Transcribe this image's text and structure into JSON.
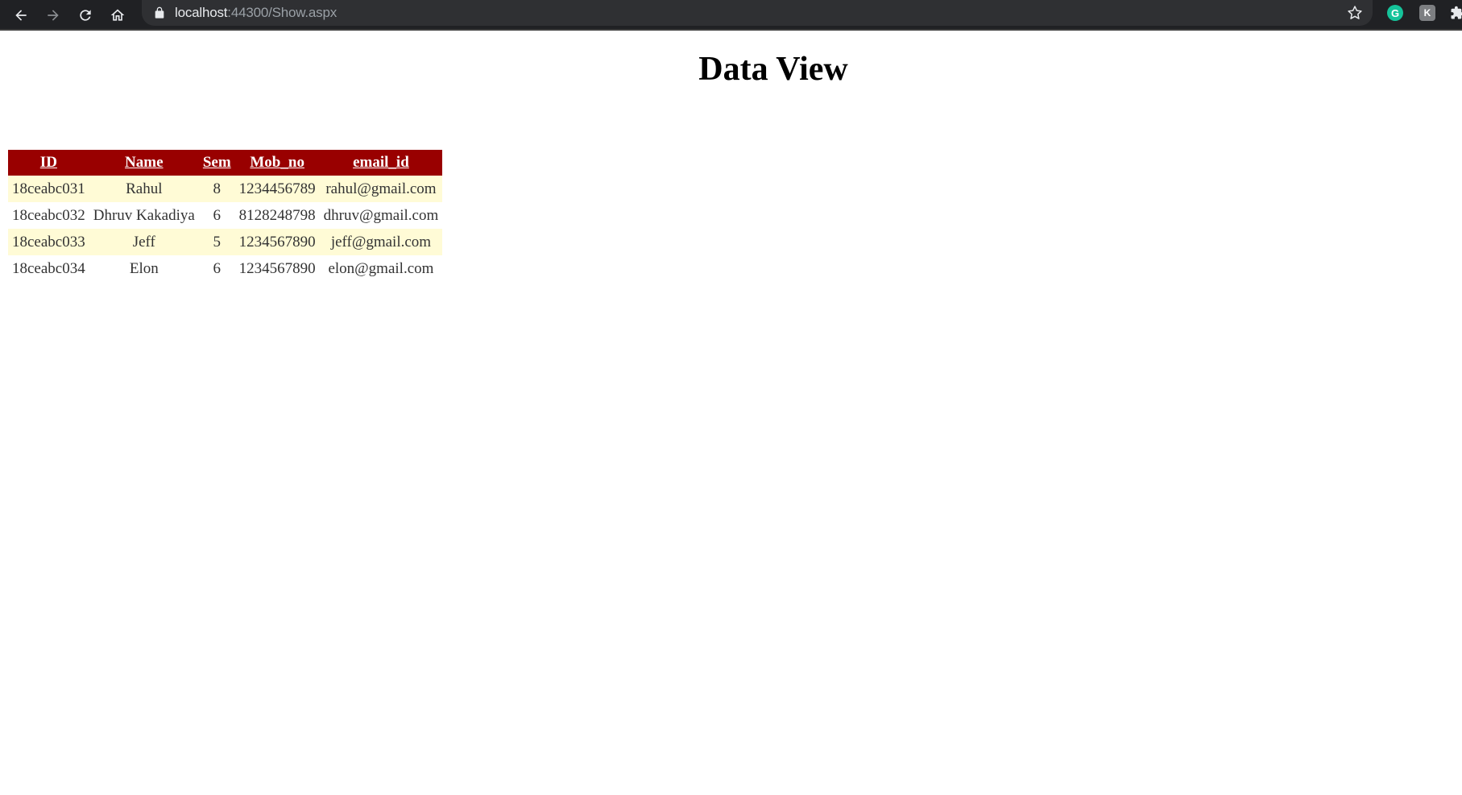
{
  "browser": {
    "url_host": "localhost",
    "url_rest": ":44300/Show.aspx",
    "extension_g_label": "G",
    "extension_k_label": "K",
    "icons": [
      "back-icon",
      "forward-icon",
      "reload-icon",
      "home-icon",
      "lock-icon",
      "star-icon",
      "extension-puzzle-icon"
    ]
  },
  "page": {
    "title": "Data View"
  },
  "grid": {
    "columns": [
      "ID",
      "Name",
      "Sem",
      "Mob_no",
      "email_id"
    ],
    "rows": [
      [
        "18ceabc031",
        "Rahul",
        "8",
        "1234456789",
        "rahul@gmail.com"
      ],
      [
        "18ceabc032",
        "Dhruv Kakadiya",
        "6",
        "8128248798",
        "dhruv@gmail.com"
      ],
      [
        "18ceabc033",
        "Jeff",
        "5",
        "1234567890",
        "jeff@gmail.com"
      ],
      [
        "18ceabc034",
        "Elon",
        "6",
        "1234567890",
        "elon@gmail.com"
      ]
    ],
    "colors": {
      "header_bg": "#990000",
      "header_text": "#ffffff",
      "alt_row_bg": "#fffbd6",
      "row_text": "#333333"
    }
  }
}
